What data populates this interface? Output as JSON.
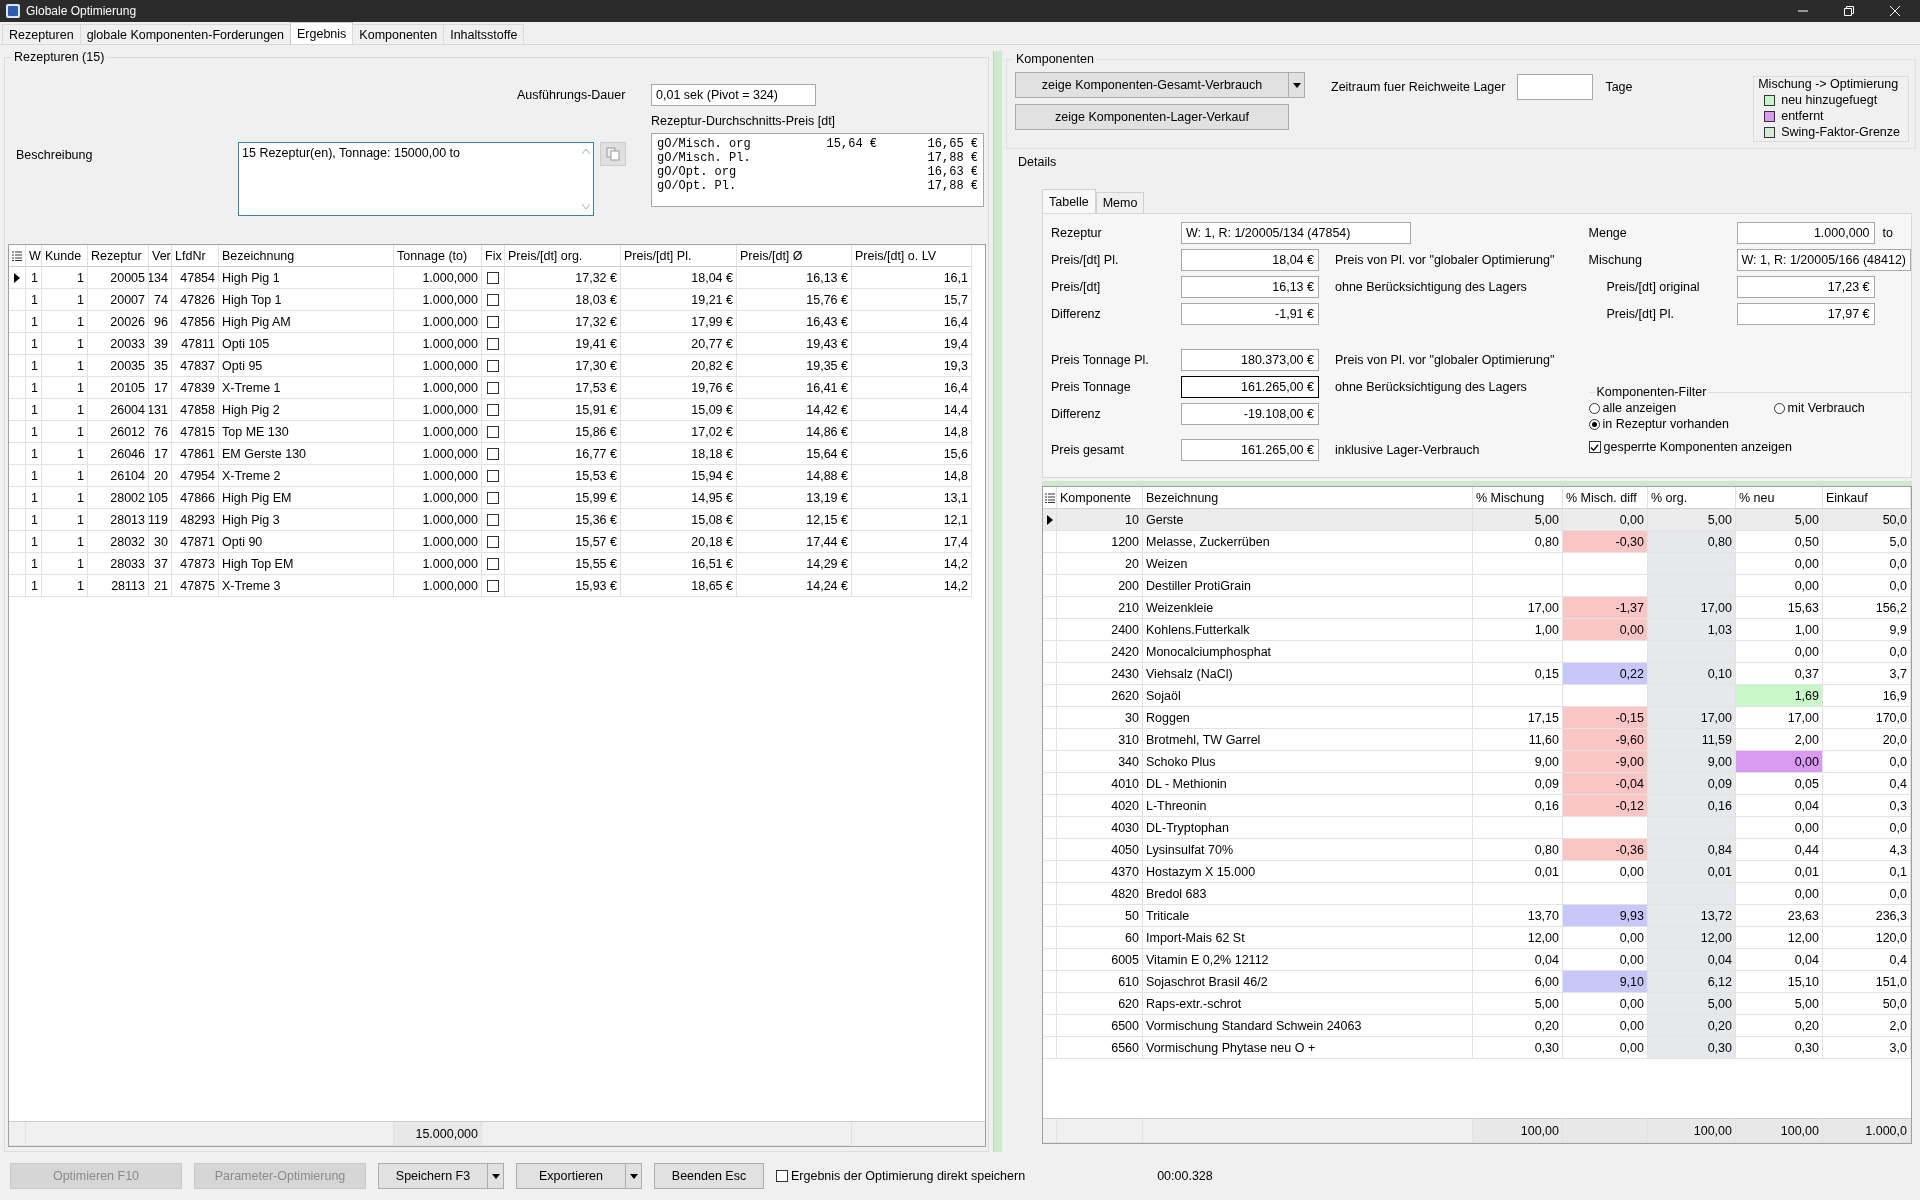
{
  "window": {
    "title": "Globale Optimierung"
  },
  "tabs": [
    {
      "label": "Rezepturen",
      "selected": false
    },
    {
      "label": "globale Komponenten-Forderungen",
      "selected": false
    },
    {
      "label": "Ergebnis",
      "selected": true
    },
    {
      "label": "Komponenten",
      "selected": false
    },
    {
      "label": "Inhaltsstoffe",
      "selected": false
    }
  ],
  "rezepturen": {
    "title": "Rezepturen (15)",
    "duration_label": "Ausführungs-Dauer",
    "duration": "0,01 sek (Pivot = 324)",
    "avg_price_label": "Rezeptur-Durchschnitts-Preis [dt]",
    "avg_price_lines": [
      {
        "label": "gO/Misch. org",
        "value_1": "15,64 €",
        "value_2": "16,65 €"
      },
      {
        "label": "gO/Misch. Pl.",
        "value_2": "17,88 €"
      },
      {
        "label": "gO/Opt. org",
        "value_2": "16,63 €"
      },
      {
        "label": "gO/Opt. Pl.",
        "value_2": "17,88 €"
      }
    ],
    "description_label": "Beschreibung",
    "description": "15 Rezeptur(en), Tonnage: 15000,00 to",
    "table": {
      "columns": [
        "W",
        "Kunde",
        "Rezeptur",
        "Ver",
        "LfdNr",
        "Bezeichnung",
        "Tonnage (to)",
        "Fix",
        "Preis/[dt] org.",
        "Preis/[dt] Pl.",
        "Preis/[dt] Ø",
        "Preis/[dt] o. LV"
      ],
      "rows": [
        {
          "selected": true,
          "cells": [
            "1",
            "1",
            "20005",
            "134",
            "47854",
            "High Pig 1",
            "1.000,000"
          ],
          "fix": false,
          "prices": [
            "17,32 €",
            "18,04 €",
            "16,13 €",
            "16,1"
          ]
        },
        {
          "selected": false,
          "cells": [
            "1",
            "1",
            "20007",
            "74",
            "47826",
            "High Top 1",
            "1.000,000"
          ],
          "fix": false,
          "prices": [
            "18,03 €",
            "19,21 €",
            "15,76 €",
            "15,7"
          ]
        },
        {
          "selected": false,
          "cells": [
            "1",
            "1",
            "20026",
            "96",
            "47856",
            "High Pig  AM",
            "1.000,000"
          ],
          "fix": false,
          "prices": [
            "17,32 €",
            "17,99 €",
            "16,43 €",
            "16,4"
          ]
        },
        {
          "selected": false,
          "cells": [
            "1",
            "1",
            "20033",
            "39",
            "47811",
            "Opti 105",
            "1.000,000"
          ],
          "fix": false,
          "prices": [
            "19,41 €",
            "20,77 €",
            "19,43 €",
            "19,4"
          ]
        },
        {
          "selected": false,
          "cells": [
            "1",
            "1",
            "20035",
            "35",
            "47837",
            "Opti 95",
            "1.000,000"
          ],
          "fix": false,
          "prices": [
            "17,30 €",
            "20,82 €",
            "19,35 €",
            "19,3"
          ]
        },
        {
          "selected": false,
          "cells": [
            "1",
            "1",
            "20105",
            "17",
            "47839",
            "X-Treme 1",
            "1.000,000"
          ],
          "fix": false,
          "prices": [
            "17,53 €",
            "19,76 €",
            "16,41 €",
            "16,4"
          ]
        },
        {
          "selected": false,
          "cells": [
            "1",
            "1",
            "26004",
            "131",
            "47858",
            "High Pig 2",
            "1.000,000"
          ],
          "fix": false,
          "prices": [
            "15,91 €",
            "15,09 €",
            "14,42 €",
            "14,4"
          ]
        },
        {
          "selected": false,
          "cells": [
            "1",
            "1",
            "26012",
            "76",
            "47815",
            "Top ME 130",
            "1.000,000"
          ],
          "fix": false,
          "prices": [
            "15,86 €",
            "17,02 €",
            "14,86 €",
            "14,8"
          ]
        },
        {
          "selected": false,
          "cells": [
            "1",
            "1",
            "26046",
            "17",
            "47861",
            "EM Gerste 130",
            "1.000,000"
          ],
          "fix": false,
          "prices": [
            "16,77 €",
            "18,18 €",
            "15,64 €",
            "15,6"
          ]
        },
        {
          "selected": false,
          "cells": [
            "1",
            "1",
            "26104",
            "20",
            "47954",
            "X-Treme 2",
            "1.000,000"
          ],
          "fix": false,
          "prices": [
            "15,53 €",
            "15,94 €",
            "14,88 €",
            "14,8"
          ]
        },
        {
          "selected": false,
          "cells": [
            "1",
            "1",
            "28002",
            "105",
            "47866",
            "High Pig EM",
            "1.000,000"
          ],
          "fix": false,
          "prices": [
            "15,99 €",
            "14,95 €",
            "13,19 €",
            "13,1"
          ]
        },
        {
          "selected": false,
          "cells": [
            "1",
            "1",
            "28013",
            "119",
            "48293",
            "High Pig 3",
            "1.000,000"
          ],
          "fix": false,
          "prices": [
            "15,36 €",
            "15,08 €",
            "12,15 €",
            "12,1"
          ]
        },
        {
          "selected": false,
          "cells": [
            "1",
            "1",
            "28032",
            "30",
            "47871",
            "Opti 90",
            "1.000,000"
          ],
          "fix": false,
          "prices": [
            "15,57 €",
            "20,18 €",
            "17,44 €",
            "17,4"
          ]
        },
        {
          "selected": false,
          "cells": [
            "1",
            "1",
            "28033",
            "37",
            "47873",
            "High Top EM",
            "1.000,000"
          ],
          "fix": false,
          "prices": [
            "15,55 €",
            "16,51 €",
            "14,29 €",
            "14,2"
          ]
        },
        {
          "selected": false,
          "cells": [
            "1",
            "1",
            "28113",
            "21",
            "47875",
            "X-Treme 3",
            "1.000,000"
          ],
          "fix": false,
          "prices": [
            "15,93 €",
            "18,65 €",
            "14,24 €",
            "14,2"
          ]
        }
      ],
      "footer_tonnage": "15.000,000"
    }
  },
  "komponenten": {
    "title": "Komponenten",
    "buttons": [
      {
        "label": "zeige Komponenten-Gesamt-Verbrauch",
        "dropdown": true
      },
      {
        "label": "zeige Komponenten-Lager-Verkauf",
        "dropdown": false
      }
    ],
    "reichweite_label": "Zeitraum fuer Reichweite Lager",
    "reichweite_unit": "Tage",
    "legend": {
      "title": "Mischung -> Optimierung",
      "items": [
        {
          "label": "neu hinzugefuegt",
          "color": "#c8f5c8"
        },
        {
          "label": "entfernt",
          "color": "#d99af2"
        },
        {
          "label": "Swing-Faktor-Grenze",
          "color": "#d6ead6"
        }
      ]
    }
  },
  "details": {
    "title": "Details",
    "tabs": [
      {
        "label": "Tabelle",
        "selected": true
      },
      {
        "label": "Memo",
        "selected": false
      }
    ],
    "form_left": [
      {
        "kind": "text",
        "label": "Rezeptur",
        "value": "W: 1, R: 1/20005/134 (47854)",
        "focused": false
      },
      {
        "kind": "number",
        "label": "Preis/[dt] Pl.",
        "value": "18,04 €",
        "note": "Preis von Pl. vor \"globaler Optimierung\"",
        "focused": false
      },
      {
        "kind": "number",
        "label": "Preis/[dt]",
        "value": "16,13 €",
        "note": "ohne Berücksichtigung des Lagers",
        "focused": false
      },
      {
        "kind": "number",
        "label": "Differenz",
        "value": "-1,91 €",
        "focused": false
      },
      {
        "kind": "gap"
      },
      {
        "kind": "number",
        "label": "Preis Tonnage Pl.",
        "value": "180.373,00 €",
        "note": "Preis von Pl. vor \"globaler Optimierung\"",
        "focused": false
      },
      {
        "kind": "number",
        "label": "Preis Tonnage",
        "value": "161.265,00 €",
        "note": "ohne Berücksichtigung des Lagers",
        "focused": true
      },
      {
        "kind": "number",
        "label": "Differenz",
        "value": "-19.108,00 €",
        "focused": false
      },
      {
        "kind": "wide-gap"
      },
      {
        "kind": "number",
        "label": "Preis gesamt",
        "value": "161.265,00 €",
        "note": "inklusive Lager-Verbrauch",
        "focused": false
      }
    ],
    "form_right": [
      {
        "kind": "number",
        "label": "Menge",
        "value": "1.000,000",
        "unit": "to"
      },
      {
        "kind": "text",
        "label": "Mischung",
        "value": "W: 1, R: 1/20005/166 (48412)"
      },
      {
        "kind": "sub",
        "label": "Preis/[dt] original",
        "value": "17,23 €"
      },
      {
        "kind": "sub",
        "label": "Preis/[dt] Pl.",
        "value": "17,97 €"
      }
    ],
    "filter": {
      "title": "Komponenten-Filter",
      "options": [
        {
          "label": "alle anzeigen",
          "selected": false
        },
        {
          "label": "mit Verbrauch",
          "selected": false
        },
        {
          "label": "in Rezeptur vorhanden",
          "selected": true
        }
      ]
    },
    "show_locked": {
      "label": "gesperrte Komponenten anzeigen",
      "checked": true
    },
    "table": {
      "columns": [
        "Komponente",
        "Bezeichnung",
        "% Mischung",
        "% Misch. diff",
        "% org.",
        "% neu",
        "Einkauf"
      ],
      "rows": [
        {
          "selected": true,
          "komponente": "10",
          "bezeichnung": "Gerste",
          "mischung": "5,00",
          "diff": {
            "value": "0,00"
          },
          "org": "5,00",
          "neu": {
            "value": "5,00"
          },
          "einkauf": "50,0"
        },
        {
          "selected": false,
          "komponente": "1200",
          "bezeichnung": "Melasse, Zuckerrüben",
          "mischung": "0,80",
          "diff": {
            "value": "-0,30",
            "color": "#f9c5c5"
          },
          "org": "0,80",
          "neu": {
            "value": "0,50"
          },
          "einkauf": "5,0"
        },
        {
          "selected": false,
          "komponente": "20",
          "bezeichnung": "Weizen",
          "diff": {},
          "neu": {
            "value": "0,00"
          },
          "einkauf": "0,0"
        },
        {
          "selected": false,
          "komponente": "200",
          "bezeichnung": "Destiller ProtiGrain",
          "diff": {},
          "neu": {
            "value": "0,00"
          },
          "einkauf": "0,0"
        },
        {
          "selected": false,
          "komponente": "210",
          "bezeichnung": "Weizenkleie",
          "mischung": "17,00",
          "diff": {
            "value": "-1,37",
            "color": "#f9c5c5"
          },
          "org": "17,00",
          "neu": {
            "value": "15,63"
          },
          "einkauf": "156,2"
        },
        {
          "selected": false,
          "komponente": "2400",
          "bezeichnung": "Kohlens.Futterkalk",
          "mischung": "1,00",
          "diff": {
            "value": "0,00",
            "color": "#f9c5c5"
          },
          "org": "1,03",
          "neu": {
            "value": "1,00"
          },
          "einkauf": "9,9"
        },
        {
          "selected": false,
          "komponente": "2420",
          "bezeichnung": "Monocalciumphosphat",
          "diff": {},
          "neu": {
            "value": "0,00"
          },
          "einkauf": "0,0"
        },
        {
          "selected": false,
          "komponente": "2430",
          "bezeichnung": "Viehsalz (NaCl)",
          "mischung": "0,15",
          "diff": {
            "value": "0,22",
            "color": "#c7c7f9"
          },
          "org": "0,10",
          "neu": {
            "value": "0,37"
          },
          "einkauf": "3,7"
        },
        {
          "selected": false,
          "komponente": "2620",
          "bezeichnung": "Sojaöl",
          "diff": {},
          "neu": {
            "value": "1,69",
            "color": "#c8f7c8"
          },
          "einkauf": "16,9"
        },
        {
          "selected": false,
          "komponente": "30",
          "bezeichnung": "Roggen",
          "mischung": "17,15",
          "diff": {
            "value": "-0,15",
            "color": "#f9c5c5"
          },
          "org": "17,00",
          "neu": {
            "value": "17,00"
          },
          "einkauf": "170,0"
        },
        {
          "selected": false,
          "komponente": "310",
          "bezeichnung": "Brotmehl, TW Garrel",
          "mischung": "11,60",
          "diff": {
            "value": "-9,60",
            "color": "#f9c5c5"
          },
          "org": "11,59",
          "neu": {
            "value": "2,00"
          },
          "einkauf": "20,0"
        },
        {
          "selected": false,
          "komponente": "340",
          "bezeichnung": "Schoko Plus",
          "mischung": "9,00",
          "diff": {
            "value": "-9,00",
            "color": "#f9c5c5"
          },
          "org": "9,00",
          "neu": {
            "value": "0,00",
            "color": "#d99af2"
          },
          "einkauf": "0,0"
        },
        {
          "selected": false,
          "komponente": "4010",
          "bezeichnung": "DL - Methionin",
          "mischung": "0,09",
          "diff": {
            "value": "-0,04",
            "color": "#f9c5c5"
          },
          "org": "0,09",
          "neu": {
            "value": "0,05"
          },
          "einkauf": "0,4"
        },
        {
          "selected": false,
          "komponente": "4020",
          "bezeichnung": "L-Threonin",
          "mischung": "0,16",
          "diff": {
            "value": "-0,12",
            "color": "#f9c5c5"
          },
          "org": "0,16",
          "neu": {
            "value": "0,04"
          },
          "einkauf": "0,3"
        },
        {
          "selected": false,
          "komponente": "4030",
          "bezeichnung": "DL-Tryptophan",
          "diff": {},
          "neu": {
            "value": "0,00"
          },
          "einkauf": "0,0"
        },
        {
          "selected": false,
          "komponente": "4050",
          "bezeichnung": "Lysinsulfat 70%",
          "mischung": "0,80",
          "diff": {
            "value": "-0,36",
            "color": "#f9c5c5"
          },
          "org": "0,84",
          "neu": {
            "value": "0,44"
          },
          "einkauf": "4,3"
        },
        {
          "selected": false,
          "komponente": "4370",
          "bezeichnung": "Hostazym X 15.000",
          "mischung": "0,01",
          "diff": {
            "value": "0,00"
          },
          "org": "0,01",
          "neu": {
            "value": "0,01"
          },
          "einkauf": "0,1"
        },
        {
          "selected": false,
          "komponente": "4820",
          "bezeichnung": "Bredol 683",
          "diff": {},
          "neu": {
            "value": "0,00"
          },
          "einkauf": "0,0"
        },
        {
          "selected": false,
          "komponente": "50",
          "bezeichnung": "Triticale",
          "mischung": "13,70",
          "diff": {
            "value": "9,93",
            "color": "#c7c7f9"
          },
          "org": "13,72",
          "neu": {
            "value": "23,63"
          },
          "einkauf": "236,3"
        },
        {
          "selected": false,
          "komponente": "60",
          "bezeichnung": "Import-Mais 62 St",
          "mischung": "12,00",
          "diff": {
            "value": "0,00"
          },
          "org": "12,00",
          "neu": {
            "value": "12,00"
          },
          "einkauf": "120,0"
        },
        {
          "selected": false,
          "komponente": "6005",
          "bezeichnung": "Vitamin E  0,2% 12112",
          "mischung": "0,04",
          "diff": {
            "value": "0,00"
          },
          "org": "0,04",
          "neu": {
            "value": "0,04"
          },
          "einkauf": "0,4"
        },
        {
          "selected": false,
          "komponente": "610",
          "bezeichnung": "Sojaschrot Brasil 46/2",
          "mischung": "6,00",
          "diff": {
            "value": "9,10",
            "color": "#c7c7f9"
          },
          "org": "6,12",
          "neu": {
            "value": "15,10"
          },
          "einkauf": "151,0"
        },
        {
          "selected": false,
          "komponente": "620",
          "bezeichnung": "Raps-extr.-schrot",
          "mischung": "5,00",
          "diff": {
            "value": "0,00"
          },
          "org": "5,00",
          "neu": {
            "value": "5,00"
          },
          "einkauf": "50,0"
        },
        {
          "selected": false,
          "komponente": "6500",
          "bezeichnung": "Vormischung Standard Schwein 24063",
          "mischung": "0,20",
          "diff": {
            "value": "0,00"
          },
          "org": "0,20",
          "neu": {
            "value": "0,20"
          },
          "einkauf": "2,0"
        },
        {
          "selected": false,
          "komponente": "6560",
          "bezeichnung": "Vormischung Phytase neu O +",
          "mischung": "0,30",
          "diff": {
            "value": "0,00"
          },
          "org": "0,30",
          "neu": {
            "value": "0,30"
          },
          "einkauf": "3,0"
        }
      ],
      "footer": {
        "mischung": "100,00",
        "org": "100,00",
        "neu": "100,00",
        "einkauf": "1.000,0"
      }
    }
  },
  "bottom_bar": {
    "buttons": [
      {
        "label": "Optimieren F10",
        "disabled": true,
        "dropdown": false
      },
      {
        "label": "Parameter-Optimierung",
        "disabled": true,
        "dropdown": false
      },
      {
        "label": "Speichern F3",
        "disabled": false,
        "dropdown": true
      },
      {
        "label": "Exportieren",
        "disabled": false,
        "dropdown": true
      },
      {
        "label": "Beenden Esc",
        "disabled": false,
        "dropdown": false
      }
    ],
    "direct_save": {
      "label": "Ergebnis der Optimierung direkt speichern",
      "checked": false
    },
    "time": "00:00.328"
  }
}
